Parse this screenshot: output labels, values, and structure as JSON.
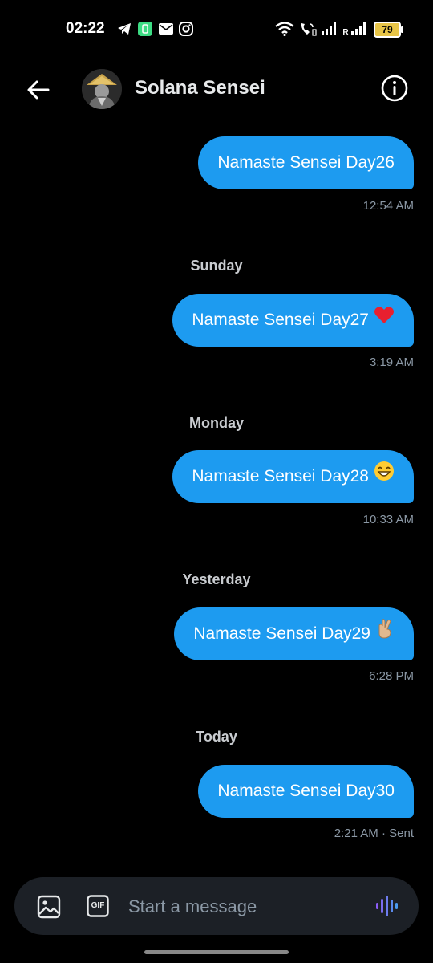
{
  "status_bar": {
    "time": "02:22",
    "battery": "79",
    "carrier_label": "R"
  },
  "header": {
    "contact_name": "Solana Sensei"
  },
  "messages": [
    {
      "text": "Namaste Sensei Day26",
      "emoji": "",
      "timestamp": "12:54 AM",
      "day_label": ""
    },
    {
      "text": "Namaste Sensei Day27",
      "emoji": "heart",
      "timestamp": "3:19 AM",
      "day_label": "Sunday"
    },
    {
      "text": "Namaste Sensei Day28",
      "emoji": "grin",
      "timestamp": "10:33 AM",
      "day_label": "Monday"
    },
    {
      "text": "Namaste Sensei Day29",
      "emoji": "crossed-fingers",
      "timestamp": "6:28 PM",
      "day_label": "Yesterday"
    },
    {
      "text": "Namaste Sensei Day30",
      "emoji": "",
      "timestamp": "2:21 AM · Sent",
      "day_label": "Today"
    }
  ],
  "composer": {
    "placeholder": "Start a message",
    "gif_label": "GIF"
  },
  "colors": {
    "bubble": "#1d9bf0",
    "background": "#000000",
    "composer_bg": "#1c2026",
    "voice_accent": "#8b5cf6"
  }
}
